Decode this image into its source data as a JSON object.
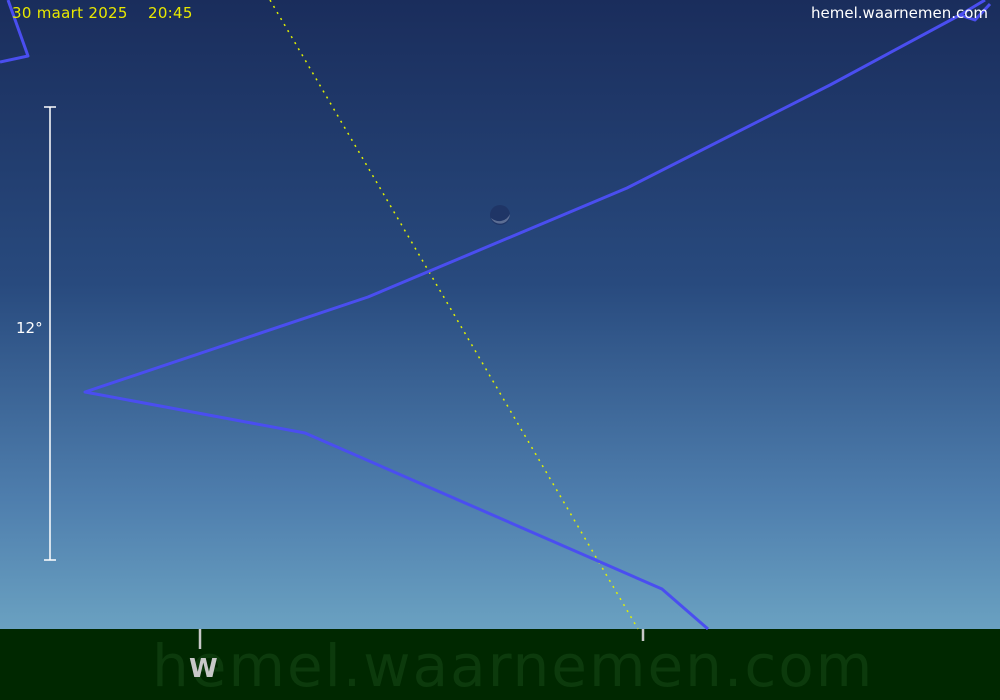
{
  "header": {
    "date": "30 maart 2025",
    "time": "20:45",
    "site": "hemel.waarnemen.com"
  },
  "scale": {
    "label": "12°"
  },
  "horizon": {
    "compass_label": "W",
    "watermark": "hemel.waarnemen.com"
  },
  "colors": {
    "sky_top": "#1a2d5c",
    "sky_bottom": "#6aa1c1",
    "ground": "#002800",
    "constellation_line": "#4a4ef0",
    "ecliptic_line": "#e0f000",
    "header_text": "#e8e800"
  },
  "icons": {
    "moon": "crescent-moon-icon"
  }
}
